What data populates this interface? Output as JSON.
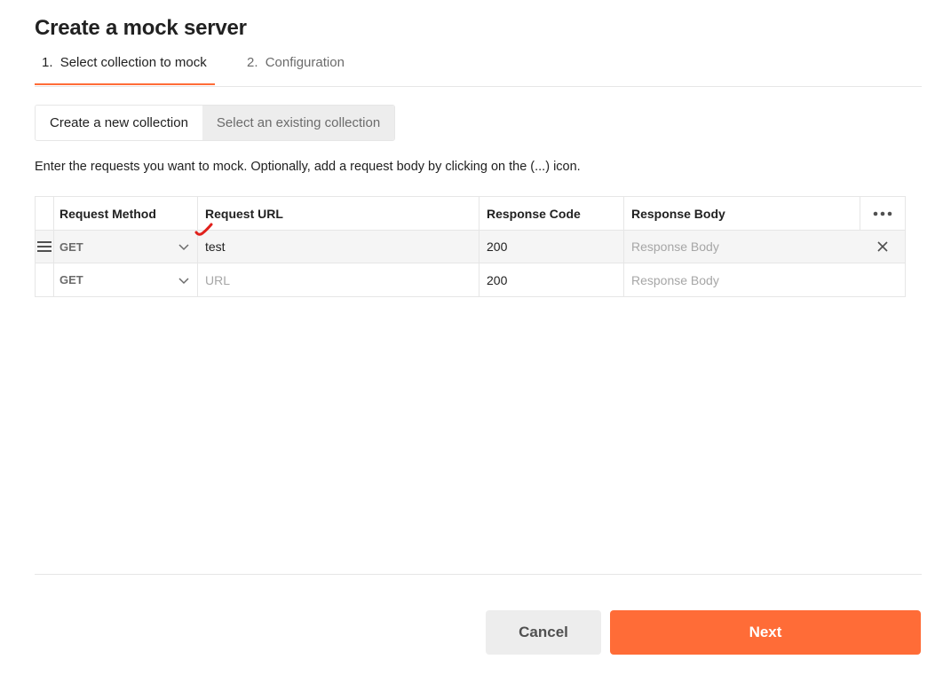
{
  "dialog": {
    "title": "Create a mock server"
  },
  "steps": [
    {
      "number": "1.",
      "label": "Select collection to mock",
      "active": true
    },
    {
      "number": "2.",
      "label": "Configuration",
      "active": false
    }
  ],
  "collection_toggle": {
    "new_label": "Create a new collection",
    "existing_label": "Select an existing collection",
    "selected": "new"
  },
  "instructions": "Enter the requests you want to mock. Optionally, add a request body by clicking on the (...) icon.",
  "table": {
    "headers": {
      "method": "Request Method",
      "url": "Request URL",
      "code": "Response Code",
      "body": "Response Body",
      "actions_icon": "more-options-icon"
    },
    "rows": [
      {
        "method": "GET",
        "url": "test",
        "url_placeholder": "URL",
        "code": "200",
        "body": "",
        "body_placeholder": "Response Body"
      },
      {
        "method": "GET",
        "url": "",
        "url_placeholder": "URL",
        "code": "200",
        "body": "",
        "body_placeholder": "Response Body"
      }
    ]
  },
  "footer": {
    "cancel_label": "Cancel",
    "next_label": "Next"
  },
  "colors": {
    "accent": "#ff6c37",
    "annotation": "#e0201b"
  }
}
